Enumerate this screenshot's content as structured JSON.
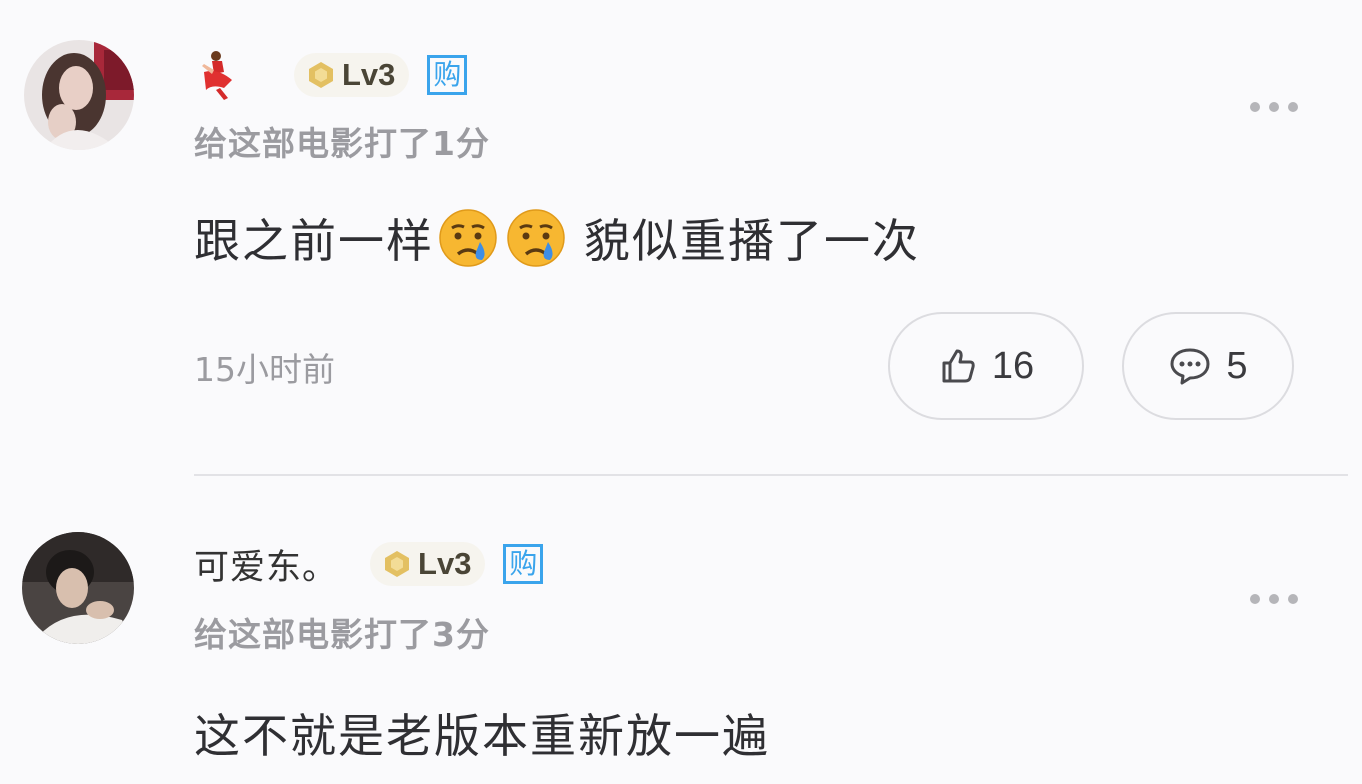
{
  "comments": [
    {
      "username": "",
      "level": "Lv3",
      "buy_badge": "购",
      "rating_text": "给这部电影打了1分",
      "content_before": "跟之前一样",
      "content_emojis": [
        "crying-face",
        "crying-face"
      ],
      "content_after": "貌似重播了一次",
      "time": "15小时前",
      "likes": "16",
      "replies": "5"
    },
    {
      "username": "可爱东。",
      "level": "Lv3",
      "buy_badge": "购",
      "rating_text": "给这部电影打了3分",
      "content_before": "这不就是老版本重新放一遍"
    }
  ],
  "colors": {
    "accent_blue": "#3aa4ec",
    "text_primary": "#2f2f33",
    "text_secondary": "#9b9ba0",
    "badge_bg": "#f6f4ee"
  }
}
